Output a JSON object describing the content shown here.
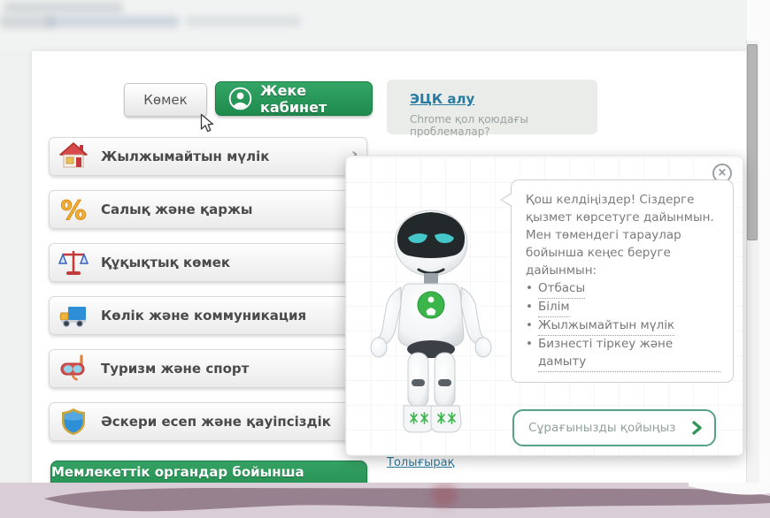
{
  "toolbar": {
    "help_label": "Көмек",
    "cabinet_label": "Жеке кабинет"
  },
  "ecp_box": {
    "link_label": "ЭЦК алу",
    "note": "Chrome қол қоюдағы проблемалар?"
  },
  "menu": {
    "items": [
      {
        "label": "Жылжымайтын мүлік",
        "icon": "house-icon"
      },
      {
        "label": "Салық және қаржы",
        "icon": "percent-icon"
      },
      {
        "label": "Құқықтық көмек",
        "icon": "scales-icon"
      },
      {
        "label": "Көлік және коммуникация",
        "icon": "truck-icon"
      },
      {
        "label": "Туризм және спорт",
        "icon": "diving-mask-icon"
      },
      {
        "label": "Әскери есеп және қауіпсіздік",
        "icon": "shield-icon"
      }
    ],
    "chevron": "›",
    "footer_button_label": "Мемлекеттік органдар бойынша қызметтер"
  },
  "assistant_popup": {
    "close_label": "×",
    "greeting": "Қош келдіңіздер! Сіздерге қызмет көрсетуге дайынмын. Мен төмендегі тараулар бойынша кеңес беруге дайынмын:",
    "bullet": "•",
    "topics": [
      "Отбасы",
      "Білім",
      "Жылжымайтын мүлік",
      "Бизнесті тіркеу және дамыту"
    ],
    "ask_button_label": "Сұрағынызды қойыңыз",
    "icons": {
      "ask_arrow": "chevron-right-icon",
      "close": "close-circle-icon",
      "cabinet": "person-icon"
    }
  },
  "page": {
    "more_link_label": "Толығырақ"
  },
  "colors": {
    "brand_green": "#23914f",
    "link_blue": "#2a7aa0",
    "wave_mauve": "#97818f",
    "bubble_text": "#7b7b7b"
  }
}
